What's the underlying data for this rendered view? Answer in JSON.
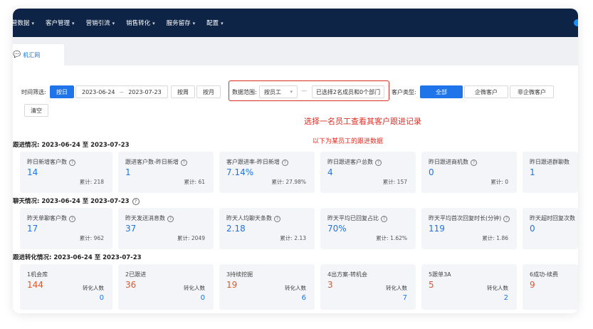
{
  "topnav": {
    "items": [
      "营数据",
      "客户管理",
      "营销引流",
      "销售转化",
      "服务留存",
      "配置"
    ]
  },
  "tab": {
    "label": "机汇网"
  },
  "filters": {
    "time_label": "时间筛选:",
    "by_day": "按日",
    "date_start": "2023-06-24",
    "date_sep": "~",
    "date_end": "2023-07-23",
    "by_week": "按周",
    "by_month": "按月",
    "clear": "清空",
    "scope_label": "数据范围:",
    "scope_select": "按员工",
    "scope_dash": "—",
    "scope_selected": "已选择2名成员和0个部门",
    "customer_type_label": "客户类型:",
    "type_all": "全部",
    "type_wecom": "企微客户",
    "type_non_wecom": "非企微客户"
  },
  "annotations": {
    "primary": "选择一名员工查看其客户跟进记录",
    "secondary": "以下为某员工的跟进数据"
  },
  "followup": {
    "title": "跟进情况: 2023-06-24 至 2023-07-23",
    "cards": [
      {
        "title": "昨日新增客户数",
        "value": "14",
        "total": "累计: 218"
      },
      {
        "title": "跟进客户数-昨日新增",
        "value": "1",
        "total": "累计: 61"
      },
      {
        "title": "客户跟进率-昨日新增",
        "value": "7.14%",
        "total": "累计: 27.98%"
      },
      {
        "title": "昨日跟进客户总数",
        "value": "4",
        "total": "累计: 157"
      },
      {
        "title": "昨日跟进商机数",
        "value": "0",
        "total": "累计: 0"
      },
      {
        "title": "昨日跟进群聊数",
        "value": "1",
        "total": ""
      }
    ]
  },
  "chat": {
    "title": "聊天情况: 2023-06-24 至 2023-07-23",
    "cards": [
      {
        "title": "昨天单聊客户数",
        "value": "17",
        "total": "累计: 962"
      },
      {
        "title": "昨天发送消息数",
        "value": "37",
        "total": "累计: 2049"
      },
      {
        "title": "昨天人均聊天条数",
        "value": "2.18",
        "total": "累计: 2.13"
      },
      {
        "title": "昨天平均已回复占比",
        "value": "70%",
        "total": "累计: 1.62%"
      },
      {
        "title": "昨天平均首次回复时长(分钟)",
        "value": "119",
        "total": "累计: 1.86"
      },
      {
        "title": "昨天超时回复次数",
        "value": "0",
        "total": ""
      }
    ]
  },
  "conversion": {
    "title": "跟进转化情况: 2023-06-24 至 2023-07-23",
    "conv_label": "转化人数",
    "cards": [
      {
        "title": "1机会库",
        "value": "144",
        "conv": "0"
      },
      {
        "title": "2已跟进",
        "value": "36",
        "conv": "0"
      },
      {
        "title": "3持续挖掘",
        "value": "19",
        "conv": "6"
      },
      {
        "title": "4出方案-转机会",
        "value": "3",
        "conv": "7"
      },
      {
        "title": "5跟单3A",
        "value": "5",
        "conv": "2"
      },
      {
        "title": "6成功-续费",
        "value": "9",
        "conv": ""
      }
    ]
  },
  "colors": {
    "accent": "#1e74e8",
    "nav_bg": "#0d2447",
    "annotation": "#e02e24",
    "stage_value": "#e0562b"
  }
}
